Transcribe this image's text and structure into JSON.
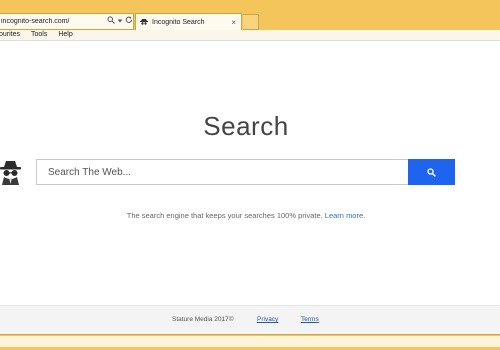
{
  "browser": {
    "address_url": "incognito-search.com/",
    "tab_title": "Incognito Search",
    "menu": [
      "ourites",
      "Tools",
      "Help"
    ]
  },
  "page": {
    "heading": "Search",
    "search": {
      "placeholder": "Search The Web..."
    },
    "tagline": "The search engine that keeps your searches 100% private.",
    "learn_more": "Learn more.",
    "footer": {
      "copyright": "Stature Media 2017©",
      "privacy": "Privacy",
      "terms": "Terms"
    }
  },
  "colors": {
    "chrome": "#f3c55a",
    "search_button": "#1e64ee",
    "link": "#2a6fd6"
  },
  "icons": [
    "search-icon",
    "refresh-icon",
    "dropdown-icon",
    "tab-favicon",
    "close-icon",
    "spy-logo-icon",
    "magnifier-icon"
  ]
}
